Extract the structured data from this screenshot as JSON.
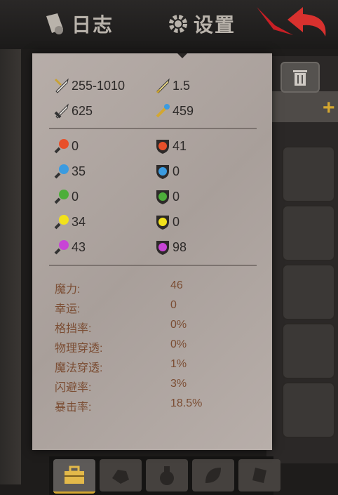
{
  "topbar": {
    "log_label": "日志",
    "settings_label": "设置"
  },
  "inventory": {
    "plus_label": "+"
  },
  "stats_top": [
    {
      "icon": "attack-sword-icon",
      "value": "255-1010"
    },
    {
      "icon": "attack-speed-sword-icon",
      "value": "1.5"
    },
    {
      "icon": "armor-pierce-sword-icon",
      "value": "625"
    },
    {
      "icon": "magic-wand-icon",
      "value": "459"
    }
  ],
  "elements": [
    {
      "attack": "0",
      "resist": "41",
      "color": "#e8502a",
      "name": "fire"
    },
    {
      "attack": "35",
      "resist": "0",
      "color": "#3b9be0",
      "name": "water"
    },
    {
      "attack": "0",
      "resist": "0",
      "color": "#4dae3a",
      "name": "nature"
    },
    {
      "attack": "34",
      "resist": "0",
      "color": "#f2e21c",
      "name": "light"
    },
    {
      "attack": "43",
      "resist": "98",
      "color": "#c845d6",
      "name": "arcane"
    }
  ],
  "attributes": [
    {
      "label": "魔力:",
      "value": "46"
    },
    {
      "label": "幸运:",
      "value": "0"
    },
    {
      "label": "格挡率:",
      "value": "0%"
    },
    {
      "label": "物理穿透:",
      "value": "0%"
    },
    {
      "label": "魔法穿透:",
      "value": "1%"
    },
    {
      "label": "闪避率:",
      "value": "3%"
    },
    {
      "label": "暴击率:",
      "value": "18.5%"
    }
  ]
}
